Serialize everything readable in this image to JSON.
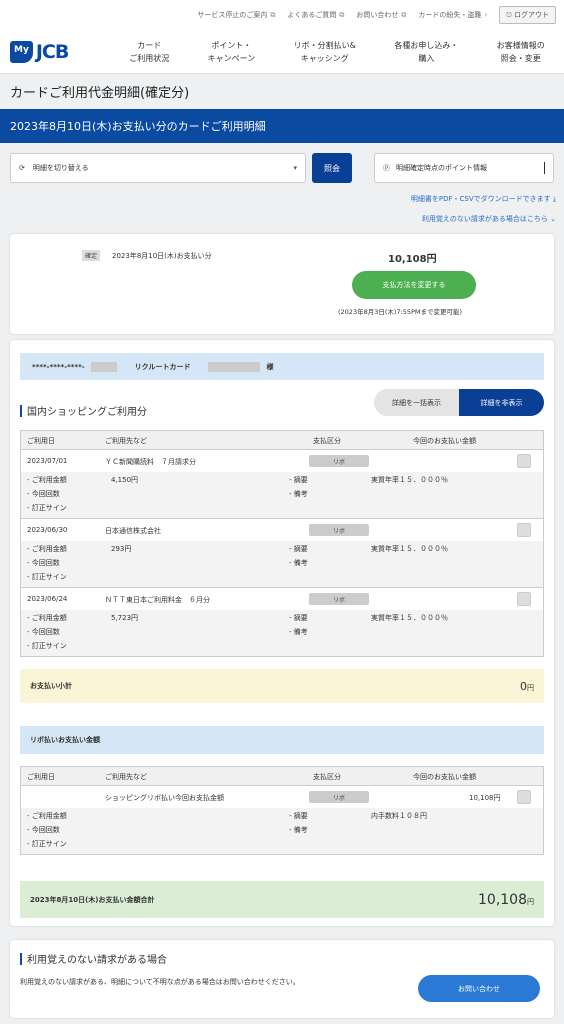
{
  "header": {
    "util_links": [
      "サービス停止のご案内",
      "よくあるご質問",
      "お問い合わせ",
      "カードの紛失・盗難"
    ],
    "logout": "ログアウト",
    "logo_my": "My",
    "logo_jcb": "JCB",
    "nav": [
      "カード\nご利用状況",
      "ポイント・\nキャンペーン",
      "リボ・分割払い&\nキャッシング",
      "各種お申し込み・\n購入",
      "お客様情報の\n照会・変更"
    ]
  },
  "page_title": "カードご利用代金明細(確定分)",
  "statement_title": "2023年8月10日(木)お支払い分のカードご利用明細",
  "controls": {
    "switch_label": "明細を切り替える",
    "query_label": "照会",
    "points_label": "明細確定時点のポイント情報",
    "download_link": "明細書をPDF・CSVでダウンロードできます",
    "unknown_link": "利用覚えのない請求がある場合はこちら"
  },
  "summary": {
    "status": "確定",
    "due_date": "2023年8月10日(木)お支払い分",
    "amount": "10,108円",
    "change_button": "支払方法を変更する",
    "deadline": "(2023年8月3日(木)7:55PMまで変更可能)"
  },
  "card": {
    "number": "****-****-****-",
    "name": "リクルートカード",
    "suffix": "様"
  },
  "domestic": {
    "title": "国内ショッピングご利用分",
    "toggle_show": "詳細を一括表示",
    "toggle_hide": "詳細を非表示",
    "columns": [
      "ご利用日",
      "ご利用先など",
      "支払区分",
      "今回のお支払い金額"
    ],
    "detail_labels": [
      "- ご利用金額",
      "- 今回回数",
      "- 訂正サイン"
    ],
    "detail_labels2": [
      "- 摘要",
      "- 備考"
    ],
    "rows": [
      {
        "date": "2023/07/01",
        "merchant": "ＹＣ新聞購読料　７月請求分",
        "type": "リボ",
        "amount": "4,150円",
        "note": "実質年率１５．０００％"
      },
      {
        "date": "2023/06/30",
        "merchant": "日本通信株式会社",
        "type": "リボ",
        "amount": "293円",
        "note": "実質年率１５．０００％"
      },
      {
        "date": "2023/06/24",
        "merchant": "ＮＴＴ東日本ご利用料金　６月分",
        "type": "リボ",
        "amount": "5,723円",
        "note": "実質年率１５．０００％"
      }
    ],
    "subtotal_label": "お支払い小計",
    "subtotal_value": "0",
    "subtotal_unit": "円"
  },
  "revolving": {
    "title": "リボ払いお支払い金額",
    "merchant": "ショッピングリボ払い今回お支払金額",
    "type": "リボ",
    "amount": "10,108円",
    "note": "内手数料１０８円"
  },
  "total": {
    "label": "2023年8月10日(木)お支払い金額合計",
    "value": "10,108",
    "unit": "円"
  },
  "inquiry": {
    "title": "利用覚えのない請求がある場合",
    "text": "利用覚えのない請求がある、明細について不明な点がある場合はお問い合わせください。",
    "button": "お問い合わせ"
  },
  "colors": {
    "brand": "#0a4aa0",
    "green": "#4caf50"
  }
}
